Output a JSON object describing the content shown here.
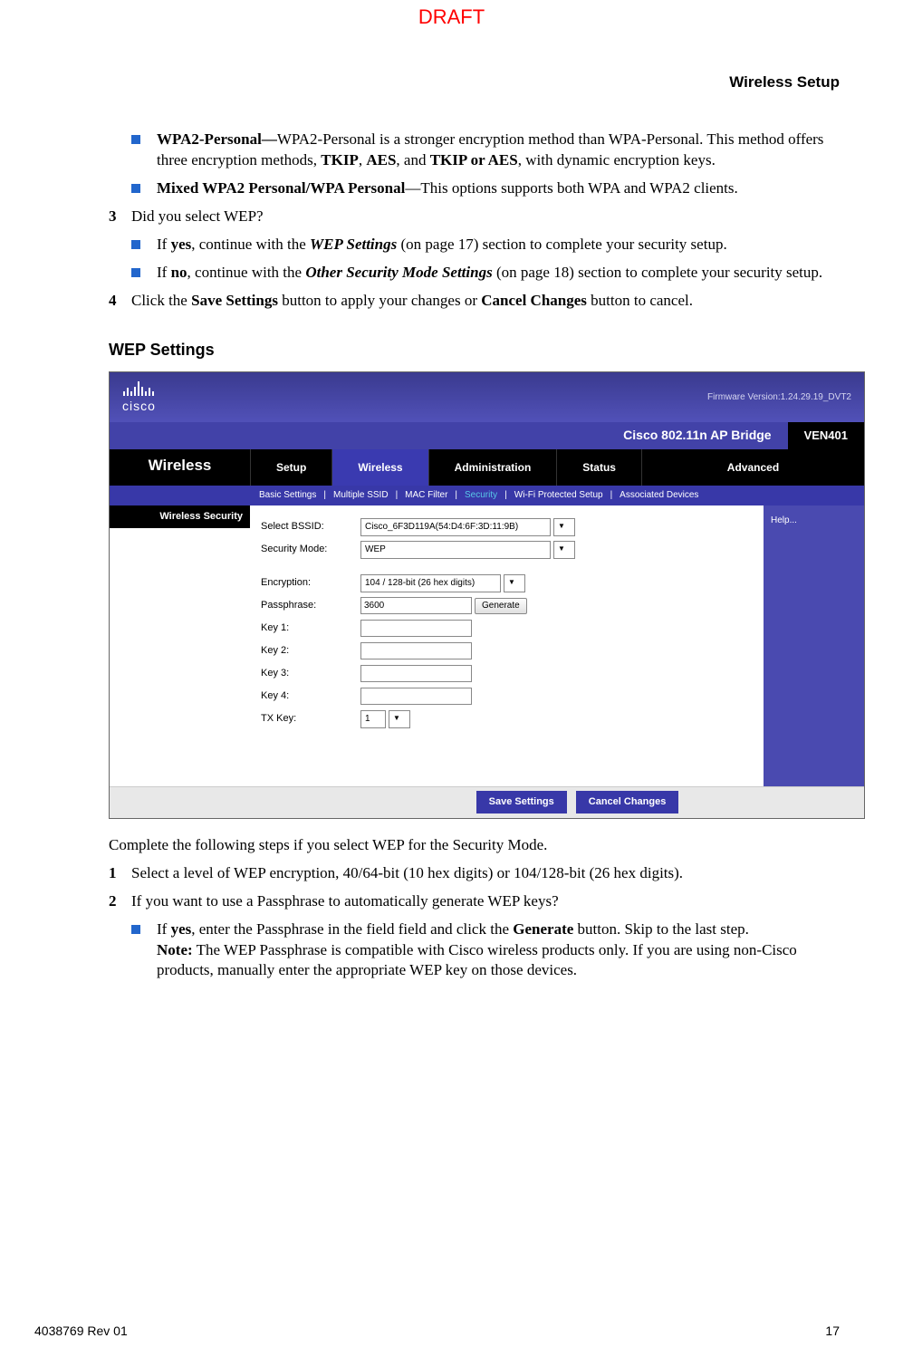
{
  "watermark": "DRAFT",
  "header": "Wireless Setup",
  "section1": {
    "b1": {
      "lead": "WPA2-Personal—",
      "rest_a": "WPA2-Personal is a stronger encryption method than WPA-Personal. This method offers three encryption methods, ",
      "tkip": "TKIP",
      "comma1": ", ",
      "aes": "AES",
      "comma2": ", and ",
      "tkip_aes": "TKIP or AES",
      "rest_b": ", with dynamic encryption keys."
    },
    "b2": {
      "lead": "Mixed WPA2 Personal/WPA Personal",
      "dash": "—",
      "rest": "This options supports both WPA and WPA2 clients."
    },
    "step3": {
      "num": "3",
      "q": "Did you select WEP?",
      "yes_a": "If ",
      "yes_b": "yes",
      "yes_c": ", continue with the ",
      "yes_link": "WEP Settings",
      "yes_d": " (on page 17) section to complete your security setup.",
      "no_a": "If ",
      "no_b": "no",
      "no_c": ", continue with the ",
      "no_link": "Other Security Mode Settings",
      "no_d": " (on page 18) section to complete your security setup."
    },
    "step4": {
      "num": "4",
      "a": "Click the ",
      "save": "Save Settings",
      "b": " button to apply your changes or ",
      "cancel": "Cancel Changes",
      "c": " button to cancel."
    }
  },
  "wep_heading": "WEP Settings",
  "ui": {
    "cisco": "cisco",
    "firmware": "Firmware Version:1.24.29.19_DVT2",
    "product": "Cisco 802.11n AP Bridge",
    "model": "VEN401",
    "nav_brand": "Wireless",
    "tabs": [
      "Setup",
      "Wireless",
      "Administration",
      "Status",
      "Advanced"
    ],
    "subtabs": [
      "Basic Settings",
      "Multiple SSID",
      "MAC Filter",
      "Security",
      "Wi-Fi Protected Setup",
      "Associated Devices"
    ],
    "panel_title": "Wireless Security",
    "help": "Help...",
    "fields": {
      "bssid_label": "Select BSSID:",
      "bssid_value": "Cisco_6F3D119A(54:D4:6F:3D:11:9B)",
      "secmode_label": "Security Mode:",
      "secmode_value": "WEP",
      "enc_label": "Encryption:",
      "enc_value": "104 / 128-bit (26 hex digits)",
      "pass_label": "Passphrase:",
      "pass_value": "3600",
      "generate": "Generate",
      "key1": "Key 1:",
      "key2": "Key 2:",
      "key3": "Key 3:",
      "key4": "Key 4:",
      "txkey_label": "TX Key:",
      "txkey_value": "1"
    },
    "buttons": {
      "save": "Save Settings",
      "cancel": "Cancel Changes"
    }
  },
  "section2": {
    "intro": "Complete the following steps if you select WEP for the Security Mode.",
    "step1": {
      "num": "1",
      "text": "Select a level of WEP encryption, 40/64-bit (10 hex digits) or 104/128-bit (26 hex digits)."
    },
    "step2": {
      "num": "2",
      "text": "If you want to use a Passphrase to automatically generate WEP keys?",
      "b1a": "If ",
      "b1b": "yes",
      "b1c": ", enter the Passphrase in the field field and click the ",
      "b1d": "Generate",
      "b1e": " button. Skip to the last step.",
      "note_lead": "Note:",
      "note_rest": " The WEP Passphrase is compatible with Cisco wireless products only. If you are using non-Cisco products, manually enter the appropriate WEP key on those devices."
    }
  },
  "footer": {
    "left": "4038769 Rev 01",
    "right": "17"
  }
}
